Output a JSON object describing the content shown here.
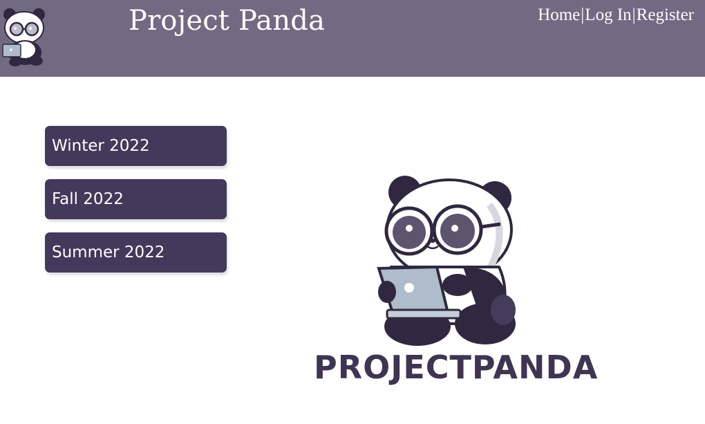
{
  "header": {
    "title": "Project Panda",
    "nav": {
      "home": "Home",
      "login": "Log In",
      "register": "Register",
      "separator": "|"
    }
  },
  "seasons": [
    {
      "label": "Winter 2022"
    },
    {
      "label": "Fall 2022"
    },
    {
      "label": "Summer 2022"
    }
  ],
  "hero": {
    "wordmark": "PROJECTPANDA"
  },
  "colors": {
    "header_bg": "#726a82",
    "button_bg": "#43395a",
    "brand_dark": "#3f3553",
    "laptop": "#aebccb"
  },
  "icons": {
    "header_logo": "panda-mascot-icon",
    "hero_logo": "panda-mascot-icon"
  }
}
